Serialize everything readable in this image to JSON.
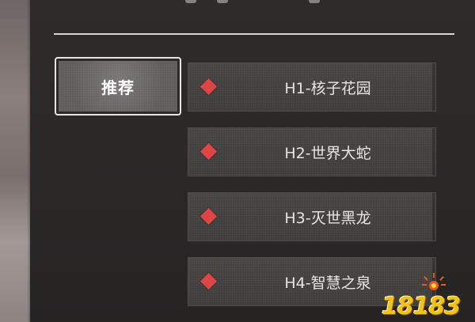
{
  "tab": {
    "label": "推荐"
  },
  "entries": [
    {
      "name": "H1-核子花园"
    },
    {
      "name": "H2-世界大蛇"
    },
    {
      "name": "H3-灭世黑龙"
    },
    {
      "name": "H4-智慧之泉"
    }
  ],
  "watermark": {
    "text": "18183"
  },
  "colors": {
    "panel": "#2a2727",
    "entry_bg": "#444141",
    "diamond": "#e04545",
    "divider": "#d9d6d6",
    "watermark": "#f3c21a"
  },
  "icons": {
    "entry_marker": "red-diamond-icon",
    "watermark_logo": "sun-logo-icon"
  }
}
